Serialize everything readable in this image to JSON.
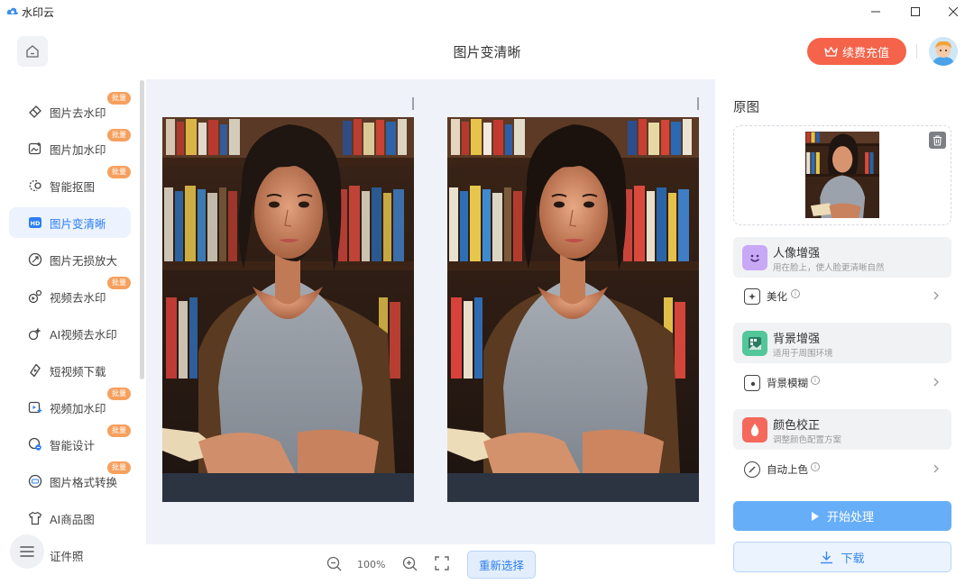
{
  "app": {
    "title": "水印云"
  },
  "header": {
    "page_title": "图片变清晰",
    "recharge_label": "续费充值"
  },
  "sidebar": {
    "items": [
      {
        "label": "图片去水印",
        "badge": "批量"
      },
      {
        "label": "图片加水印",
        "badge": "批量"
      },
      {
        "label": "智能抠图",
        "badge": "批量"
      },
      {
        "label": "图片变清晰",
        "badge": ""
      },
      {
        "label": "图片无损放大",
        "badge": ""
      },
      {
        "label": "视频去水印",
        "badge": "批量"
      },
      {
        "label": "AI视频去水印",
        "badge": ""
      },
      {
        "label": "短视频下载",
        "badge": ""
      },
      {
        "label": "视频加水印",
        "badge": "批量"
      },
      {
        "label": "智能设计",
        "badge": "批量"
      },
      {
        "label": "图片格式转换",
        "badge": "批量"
      },
      {
        "label": "AI商品图",
        "badge": ""
      },
      {
        "label": "证件照",
        "badge": ""
      }
    ],
    "active_index": 3
  },
  "zoom": {
    "value": "100%",
    "reselect_label": "重新选择"
  },
  "right_panel": {
    "original_title": "原图",
    "features": [
      {
        "title": "人像增强",
        "subtitle": "用在脸上，使人脸更清晰自然",
        "icon": "smile-face-icon",
        "color": "#c8a9f5"
      },
      {
        "title": "背景增强",
        "subtitle": "适用于周围环境",
        "icon": "landscape-grid-icon",
        "color": "#53c79a"
      },
      {
        "title": "颜色校正",
        "subtitle": "调整颜色配置方案",
        "icon": "drop-icon",
        "color": "#f4695c"
      }
    ],
    "options": [
      {
        "label": "美化",
        "icon": "beautify-icon"
      },
      {
        "label": "背景模糊",
        "icon": "blur-icon"
      },
      {
        "label": "自动上色",
        "icon": "colorize-icon"
      }
    ],
    "start_label": "开始处理",
    "download_label": "下载"
  },
  "colors": {
    "accent": "#2c7ef2",
    "recharge": "#f4634a",
    "badge": "#f6a05e",
    "start": "#66aef8"
  }
}
